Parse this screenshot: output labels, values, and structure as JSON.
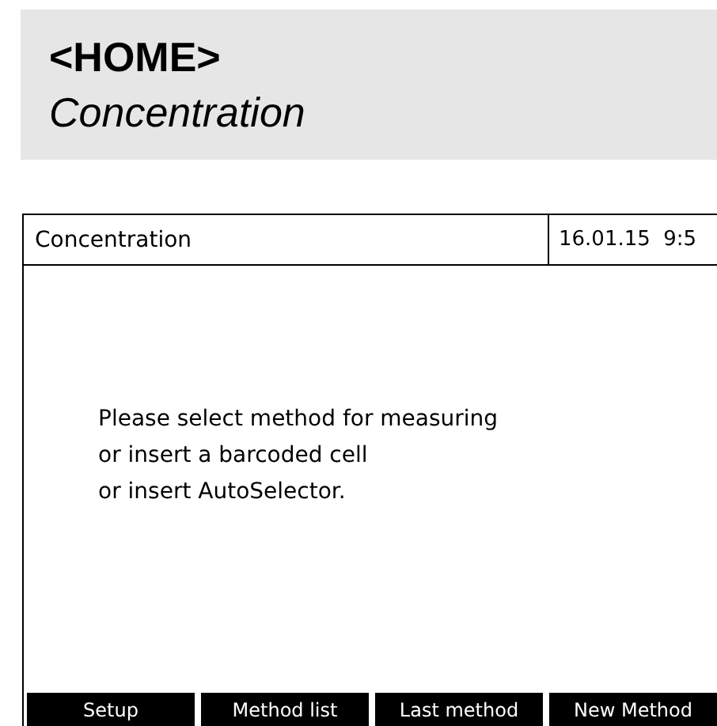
{
  "header": {
    "title": "<HOME>",
    "subtitle": "Concentration"
  },
  "screen": {
    "title": "Concentration",
    "datetime": "16.01.15  9:5",
    "message": [
      "Please select method for measuring",
      "or insert a barcoded cell",
      "or insert AutoSelector."
    ],
    "softkeys": [
      {
        "label": "Setup"
      },
      {
        "label": "Method list"
      },
      {
        "label": "Last method"
      },
      {
        "label": "New Method"
      }
    ]
  }
}
